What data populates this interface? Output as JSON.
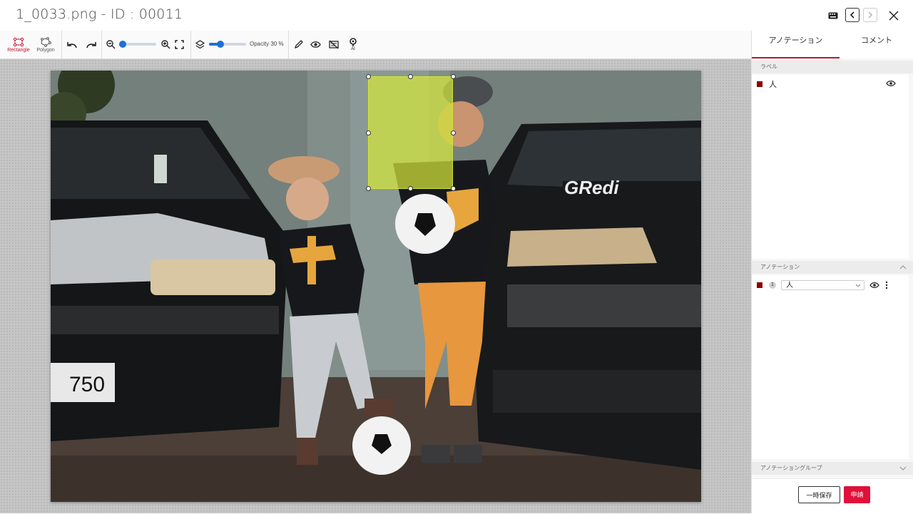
{
  "window": {
    "title": "1_0033.png - ID : 00011"
  },
  "toolbar": {
    "rectangle_label": "Rectangle",
    "polygon_label": "Polygon",
    "opacity_label": "Opacity 30 %",
    "ai_label": "AI",
    "zoom_level": 0,
    "opacity_level": 0.3
  },
  "sidebar": {
    "tabs": [
      {
        "label": "アノテーション"
      },
      {
        "label": "コメント"
      }
    ],
    "label_section": {
      "title": "ラベル",
      "items": [
        {
          "name": "人",
          "color": "#8b0000"
        }
      ]
    },
    "annotation_section": {
      "title": "アノテーション",
      "items": [
        {
          "index": "1",
          "label": "人",
          "color": "#8b0000"
        }
      ]
    },
    "group_section": {
      "title": "アノテーショングループ"
    },
    "buttons": {
      "save_temp": "一時保存",
      "apply": "申請"
    }
  },
  "colors": {
    "accent": "#c8102e",
    "apply": "#e0103a",
    "bbox_fill": "#d2e63c"
  }
}
